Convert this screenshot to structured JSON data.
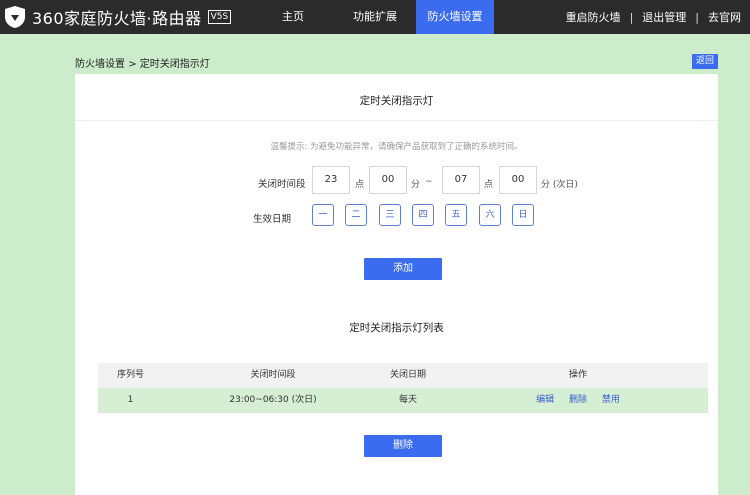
{
  "header": {
    "logo_text": "360家庭防火墙·路由器",
    "logo_badge": "V5S",
    "nav": {
      "home": "主页",
      "extensions": "功能扩展",
      "firewall_settings": "防火墙设置"
    },
    "right": {
      "restart": "重启防火墙",
      "logout": "退出管理",
      "official_site": "去官网",
      "separator": "|"
    },
    "active_nav_color": "#3b6cf0"
  },
  "breadcrumb": {
    "parent": "防火墙设置",
    "separator": ">",
    "current": "定时关闭指示灯"
  },
  "back_button": "返回",
  "panel": {
    "title": "定时关闭指示灯",
    "tip": "温馨提示: 为避免功能异常，请确保产品获取到了正确的系统时间。",
    "time_label": "关闭时间段",
    "start_hour": "23",
    "start_minute": "00",
    "end_hour": "07",
    "end_minute": "00",
    "unit_hour": "点",
    "unit_minute": "分",
    "range_sep": "~",
    "unit_minute_next": "分 (次日)",
    "days_label": "生效日期",
    "days": [
      "一",
      "二",
      "三",
      "四",
      "五",
      "六",
      "日"
    ],
    "add_button": "添加",
    "list_title": "定时关闭指示灯列表",
    "table": {
      "headers": [
        "序列号",
        "关闭时间段",
        "关闭日期",
        "操作"
      ],
      "rows": [
        {
          "index": "1",
          "period": "23:00~06:30 (次日)",
          "date": "每天",
          "actions": [
            "编辑",
            "删除",
            "禁用"
          ]
        }
      ]
    },
    "delete_button": "删除"
  }
}
